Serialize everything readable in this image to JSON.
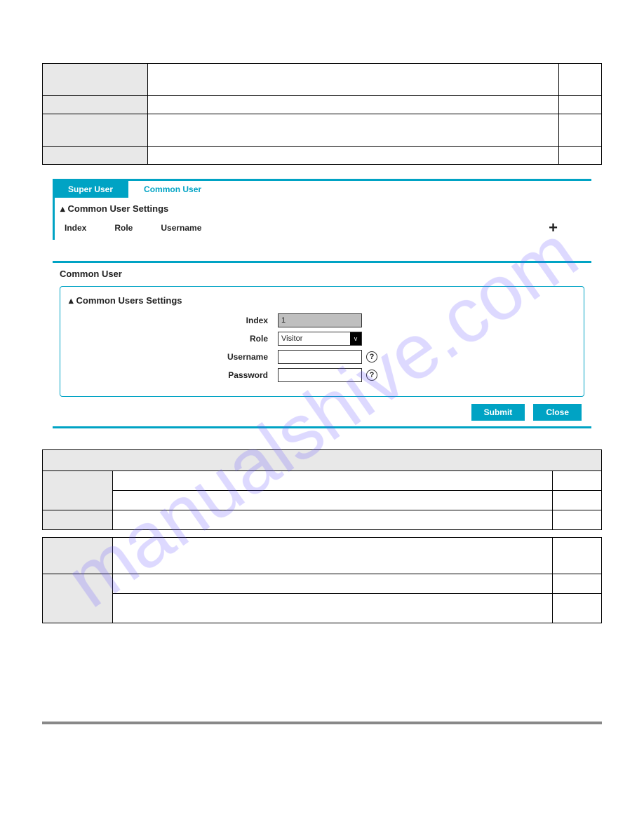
{
  "watermark": "manualshive.com",
  "tabs": {
    "super_user": "Super User",
    "common_user": "Common User"
  },
  "panel1": {
    "title": "Common User Settings",
    "cols": {
      "index": "Index",
      "role": "Role",
      "username": "Username"
    }
  },
  "panel2": {
    "header": "Common User",
    "title": "Common Users Settings",
    "labels": {
      "index": "Index",
      "role": "Role",
      "username": "Username",
      "password": "Password"
    },
    "values": {
      "index": "1",
      "role": "Visitor",
      "username": "",
      "password": ""
    },
    "buttons": {
      "submit": "Submit",
      "close": "Close"
    }
  }
}
